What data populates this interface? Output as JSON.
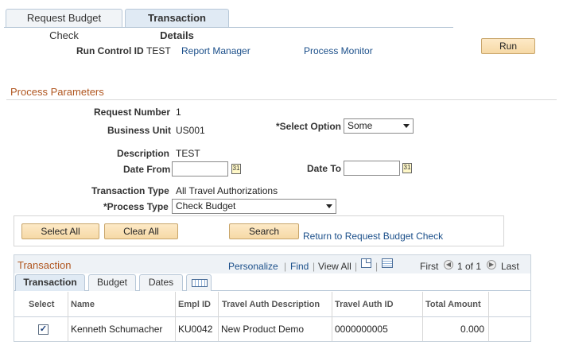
{
  "tabs": [
    {
      "label": "Request Budget Check"
    },
    {
      "label": "Transaction Details"
    }
  ],
  "header": {
    "run_control_label": "Run Control ID",
    "run_control_value": "TEST",
    "report_manager": "Report Manager",
    "process_monitor": "Process Monitor",
    "run_button": "Run"
  },
  "params": {
    "title": "Process Parameters",
    "request_number_label": "Request Number",
    "request_number_value": "1",
    "business_unit_label": "Business Unit",
    "business_unit_value": "US001",
    "select_option_label": "*Select Option",
    "select_option_value": "Some",
    "description_label": "Description",
    "description_value": "TEST",
    "date_from_label": "Date From",
    "date_from_value": "",
    "date_to_label": "Date To",
    "date_to_value": "",
    "transaction_type_label": "Transaction Type",
    "transaction_type_value": "All Travel Authorizations",
    "process_type_label": "*Process Type",
    "process_type_value": "Check Budget"
  },
  "actions": {
    "select_all": "Select All",
    "clear_all": "Clear All",
    "search": "Search",
    "return_link": "Return to Request Budget Check"
  },
  "grid": {
    "title": "Transaction",
    "personalize": "Personalize",
    "find": "Find",
    "view_all": "View All",
    "first": "First",
    "range": "1 of 1",
    "last": "Last",
    "subtabs": [
      {
        "label": "Transaction"
      },
      {
        "label": "Budget"
      },
      {
        "label": "Dates"
      }
    ],
    "columns": [
      "Select",
      "Name",
      "Empl ID",
      "Travel Auth Description",
      "Travel Auth ID",
      "Total Amount"
    ],
    "rows": [
      {
        "selected": true,
        "name": "Kenneth Schumacher",
        "empl_id": "KU0042",
        "description": "New Product Demo",
        "auth_id": "0000000005",
        "amount": "0.000"
      }
    ]
  }
}
